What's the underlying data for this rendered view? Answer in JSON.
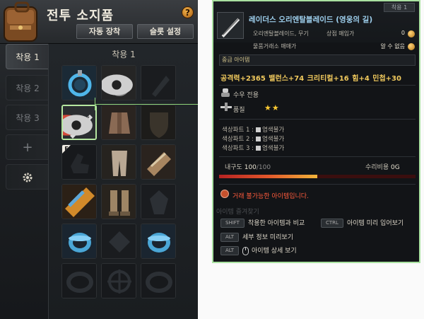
{
  "inventory": {
    "title": "전투 소지품",
    "help_label": "?",
    "auto_equip": "자동 장착",
    "slot_setting": "슬롯 설정",
    "tabs": [
      "착용 1",
      "착용 2",
      "착용 3"
    ],
    "add_tab": "+",
    "equip_set_label": "착용 1",
    "f_badge": "F"
  },
  "tooltip": {
    "badge": "착용 1",
    "item_name": "레이더스 오리엔탈블레이드 (영웅의 길)",
    "item_type": "오리엔탈블레이드, 무기",
    "shop_label": "상점 매입가",
    "shop_value": "0",
    "trade_label": "물품거래소 매매가",
    "trade_value": "알 수 없음",
    "grade": "중급 아이템",
    "stats": "공격력+2365  밸런스+74  크리티컬+16  힘+4  민첩+30",
    "class": "수우 전용",
    "quality_label": "품질",
    "quality_stars": "★★",
    "dyes": [
      {
        "part": "색상파트 1 :",
        "value": "염색불가"
      },
      {
        "part": "색상파트 2 :",
        "value": "염색불가"
      },
      {
        "part": "색상파트 3 :",
        "value": "염색불가"
      }
    ],
    "durability_label": "내구도",
    "durability_current": "100",
    "durability_max": "/100",
    "durability_fraction": 0.5,
    "repair_label": "수리비용",
    "repair_value": "0G",
    "no_trade": "거래 불가능한 아이템입니다.",
    "ghost_text": "아이템 즐겨찾기",
    "hints": [
      {
        "key": "SHIFT",
        "text": "착용한 아이템과 비교"
      },
      {
        "key": "CTRL",
        "text": "아이템 미리 입어보기"
      },
      {
        "key": "ALT",
        "text": "세부 정보 미리보기"
      },
      {
        "key": "ALT",
        "text": "아이템 상세 보기"
      }
    ]
  },
  "colors": {
    "tooltip_border": "#a9e1a0",
    "item_name": "#9ed0ee",
    "stats": "#f0c95d",
    "no_trade": "#ff5b3c",
    "stars": "#ffcc33"
  },
  "icons": [
    "bag-icon",
    "help-icon",
    "gear-icon",
    "eye-icon",
    "coin-icon",
    "class-icon",
    "quality-icon",
    "trade-icon",
    "mouse-icon"
  ]
}
